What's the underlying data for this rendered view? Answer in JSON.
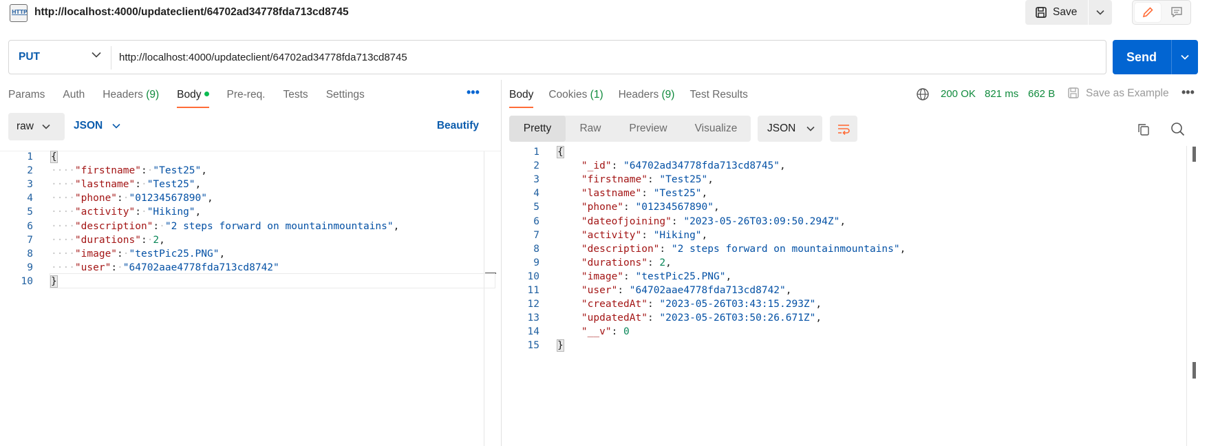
{
  "title": {
    "icon": "HTTP",
    "url": "http://localhost:4000/updateclient/64702ad34778fda713cd8745",
    "save_label": "Save"
  },
  "request": {
    "method": "PUT",
    "url": "http://localhost:4000/updateclient/64702ad34778fda713cd8745",
    "send_label": "Send"
  },
  "request_tabs": [
    {
      "label": "Params"
    },
    {
      "label": "Auth"
    },
    {
      "label": "Headers",
      "count": "(9)"
    },
    {
      "label": "Body",
      "active": true
    },
    {
      "label": "Pre-req."
    },
    {
      "label": "Tests"
    },
    {
      "label": "Settings"
    }
  ],
  "body_toolbar": {
    "mode": "raw",
    "language": "JSON",
    "beautify_label": "Beautify"
  },
  "request_body": [
    "{",
    "    \"firstname\": \"Test25\",",
    "    \"lastname\": \"Test25\",",
    "    \"phone\": \"01234567890\",",
    "    \"activity\": \"Hiking\",",
    "    \"description\": \"2 steps forward on mountainmountains\",",
    "    \"durations\": 2,",
    "    \"image\": \"testPic25.PNG\",",
    "    \"user\": \"64702aae4778fda713cd8742\"",
    "}"
  ],
  "response_tabs": [
    {
      "label": "Body",
      "active": true
    },
    {
      "label": "Cookies",
      "count": "(1)"
    },
    {
      "label": "Headers",
      "count": "(9)"
    },
    {
      "label": "Test Results"
    }
  ],
  "response_status": {
    "status": "200 OK",
    "time": "821 ms",
    "size": "662 B",
    "save_example_label": "Save as Example"
  },
  "response_toolbar": {
    "views": [
      "Pretty",
      "Raw",
      "Preview",
      "Visualize"
    ],
    "active_view": "Pretty",
    "format": "JSON"
  },
  "response_body": [
    "{",
    "    \"_id\": \"64702ad34778fda713cd8745\",",
    "    \"firstname\": \"Test25\",",
    "    \"lastname\": \"Test25\",",
    "    \"phone\": \"01234567890\",",
    "    \"dateofjoining\": \"2023-05-26T03:09:50.294Z\",",
    "    \"activity\": \"Hiking\",",
    "    \"description\": \"2 steps forward on mountainmountains\",",
    "    \"durations\": 2,",
    "    \"image\": \"testPic25.PNG\",",
    "    \"user\": \"64702aae4778fda713cd8742\",",
    "    \"createdAt\": \"2023-05-26T03:43:15.293Z\",",
    "    \"updatedAt\": \"2023-05-26T03:50:26.671Z\",",
    "    \"__v\": 0",
    "}"
  ],
  "colors": {
    "accent": "#ff6c37",
    "send": "#0265d2",
    "json_key": "#a31515",
    "json_string": "#0451a5",
    "json_number": "#098658",
    "status_ok": "#0f8a3c"
  }
}
